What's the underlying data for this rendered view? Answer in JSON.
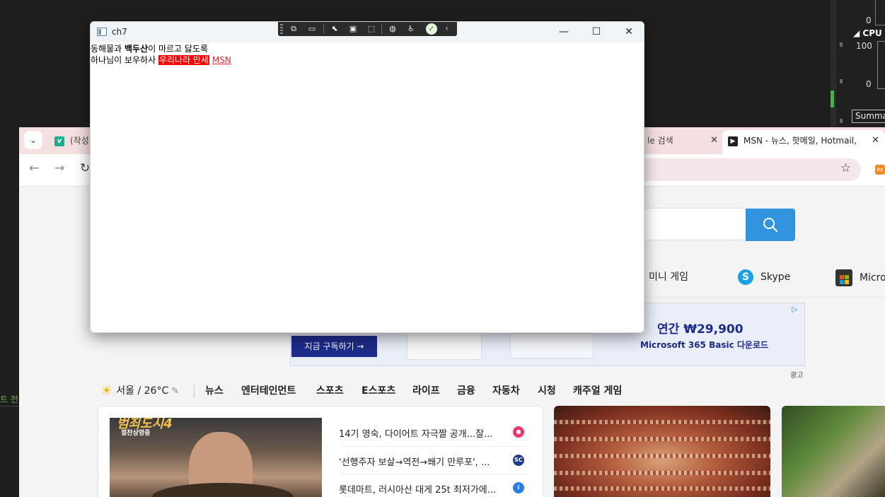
{
  "background": {
    "task_manager": {
      "zero_top": "0",
      "cpu_label": "CPU (",
      "hundred": "100",
      "zero_bottom": "0",
      "summary_tab": "Summa"
    },
    "ide_text": "트 전"
  },
  "browser": {
    "tabs": [
      {
        "label": "(작성",
        "icon": "v-icon"
      },
      {
        "label": "le 검색",
        "close": "✕"
      },
      {
        "label": "MSN - 뉴스, 핫메일, Hotmail, S",
        "close": "✕",
        "active": true
      }
    ],
    "tab_menu_icon": "⌄",
    "nav": {
      "back": "←",
      "forward": "→",
      "reload": "↻"
    },
    "star": "☆",
    "ext_badge": "ex",
    "search_button_icon": "search-icon",
    "quick_links": [
      {
        "label": "미니 게임"
      },
      {
        "label": "Skype",
        "icon": "S"
      },
      {
        "label": "Micro"
      }
    ],
    "ad": {
      "subscribe_button": "지금 구독하기 →",
      "price": "연간 ₩29,900",
      "description": "Microsoft 365 Basic 다운로드",
      "label": "광고"
    },
    "weather": {
      "text": "서울 / 26°C",
      "icon": "☀",
      "edit_icon": "✎"
    },
    "categories": [
      "뉴스",
      "엔터테인먼트",
      "스포츠",
      "E스포츠",
      "라이프",
      "금융",
      "자동차",
      "시청",
      "캐주얼 게임"
    ],
    "feature_image": {
      "title": "범죄도시4",
      "subtitle": "절찬상영중"
    },
    "headlines": [
      {
        "text": "14기 영숙, 다이어트 자극짤 공개...잘...",
        "source_color": "#e8386f",
        "source_text": "●"
      },
      {
        "text": "'선행주자 보살→역전→쐐기 만루포', ...",
        "source_color": "#1e3a8a",
        "source_text": "SC"
      },
      {
        "text": "롯데마트, 러시아산 대게 25t 최저가에...",
        "source_color": "#2b7de9",
        "source_text": "i"
      }
    ]
  },
  "ch7_window": {
    "title": "ch7",
    "controls": {
      "minimize": "—",
      "maximize": "☐",
      "close": "✕"
    },
    "line1": {
      "before": "동해물과 ",
      "bold": "백두산",
      "after": "이 마르고 닳도록"
    },
    "line2": {
      "before": "하나님이 보우하사 ",
      "highlight": "우리나라 만세",
      "space": " ",
      "link": "MSN"
    },
    "colors": {
      "highlight_bg": "#ff0000",
      "link": "#e8242c"
    }
  }
}
